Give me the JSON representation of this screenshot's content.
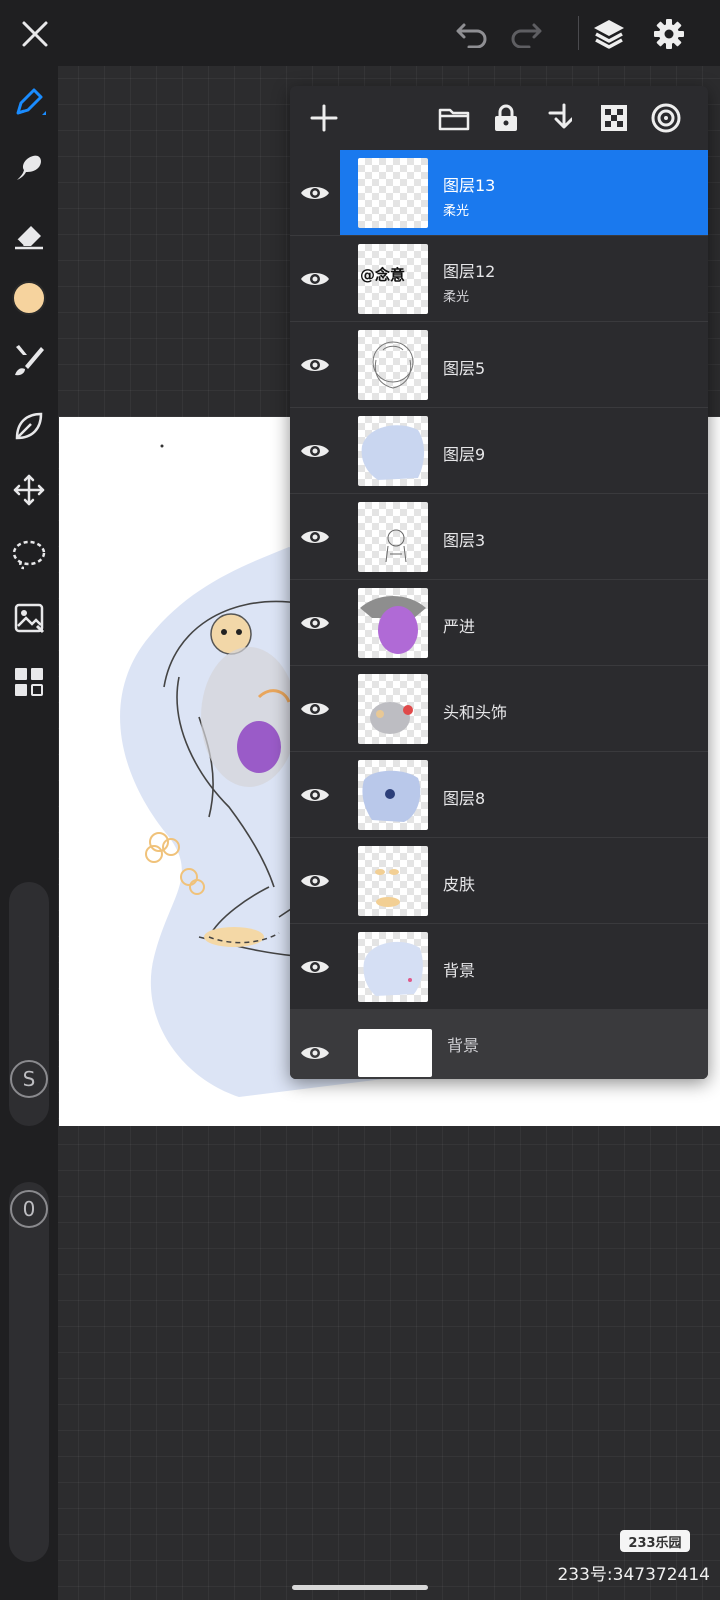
{
  "top_bar": {
    "close_icon": "close-icon",
    "undo_icon": "undo-icon",
    "redo_icon": "redo-icon",
    "layers_icon": "layers-icon",
    "settings_icon": "gear-icon"
  },
  "toolbar": {
    "tools": [
      "pen-icon",
      "smudge-icon",
      "eraser-icon",
      "color-swatch",
      "brush-icon",
      "leaf-icon",
      "transform-icon",
      "lasso-icon",
      "image-adjust-icon",
      "grid-icon"
    ],
    "current_color": "#f6d39e",
    "size_slider_label": "S",
    "opacity_slider_label": "0"
  },
  "layers_panel": {
    "actions": [
      "add-layer-icon",
      "folder-icon",
      "lock-icon",
      "merge-down-icon",
      "alpha-icon",
      "mask-icon"
    ],
    "layers": [
      {
        "name": "图层13",
        "blend": "柔光",
        "selected": true
      },
      {
        "name": "图层12",
        "blend": "柔光",
        "selected": false
      },
      {
        "name": "图层5",
        "blend": "",
        "selected": false
      },
      {
        "name": "图层9",
        "blend": "",
        "selected": false
      },
      {
        "name": "图层3",
        "blend": "",
        "selected": false
      },
      {
        "name": "严进",
        "blend": "",
        "selected": false
      },
      {
        "name": "头和头饰",
        "blend": "",
        "selected": false
      },
      {
        "name": "图层8",
        "blend": "",
        "selected": false
      },
      {
        "name": "皮肤",
        "blend": "",
        "selected": false
      },
      {
        "name": "背景",
        "blend": "",
        "selected": false
      }
    ],
    "background_layer": {
      "name": "背景"
    },
    "thumb_texts": {
      "layer12": "@念意"
    }
  },
  "watermark": {
    "badge": "233乐园",
    "id_text": "233号:347372414"
  },
  "colors": {
    "accent": "#1a79ee",
    "panel": "#2b2b2e",
    "toolbar": "#1f1f21"
  }
}
